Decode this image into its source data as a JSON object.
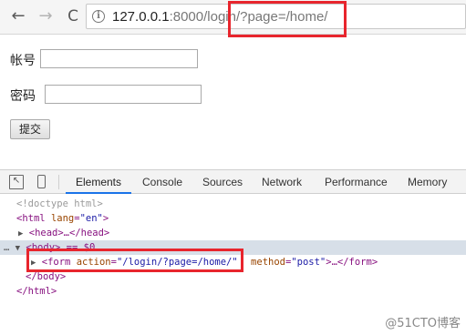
{
  "browser": {
    "url_host": "127.0.0.1",
    "url_rest": ":8000/login/?page=/home/",
    "back_label": "←",
    "forward_label": "→",
    "reload_label": "C",
    "info_label": "i"
  },
  "page": {
    "account_label": "帐号",
    "password_label": "密码",
    "submit_label": "提交"
  },
  "devtools": {
    "tabs": [
      "Elements",
      "Console",
      "Sources",
      "Network",
      "Performance",
      "Memory"
    ],
    "active_tab": "Elements",
    "lines": {
      "doctype": "<!doctype html>",
      "html_open_tag": "<html",
      "html_lang_attr": "lang",
      "html_lang_val": "\"en\"",
      "head_text": "<head>…</head>",
      "body_text": "<body> == $0",
      "form_tag": "<form",
      "form_action_attr": "action",
      "form_action_val": "\"/login/?page=/home/\"",
      "form_method_attr": "method",
      "form_method_val": "\"post\"",
      "form_close": ">…</form>",
      "body_close": "</body>",
      "html_close": "</html>"
    }
  },
  "watermark": "@51CTO博客"
}
